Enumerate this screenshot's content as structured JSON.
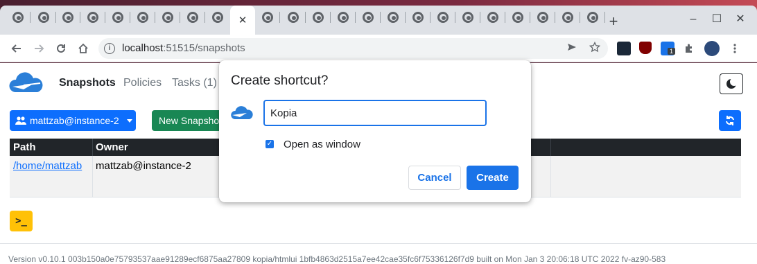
{
  "browser": {
    "active_tab_close_glyph": "✕",
    "new_tab_glyph": "+",
    "window_controls": [
      "–",
      "☐",
      "✕"
    ],
    "url_host": "localhost",
    "url_rest": ":51515/snapshots",
    "extension_badge": "1",
    "colors": {
      "tab_strip": "#dee1e6",
      "accent": "#1a73e8"
    }
  },
  "app": {
    "nav": {
      "snapshots": "Snapshots",
      "policies": "Policies",
      "tasks": "Tasks (1)"
    },
    "user_button": "mattzab@instance-2",
    "new_snapshot_button": "New Snapshot",
    "table": {
      "headers": [
        "Path",
        "Owner"
      ],
      "rows": [
        {
          "path": "/home/mattzab",
          "owner": "mattzab@instance-2"
        }
      ]
    },
    "terminal_button": ">_",
    "footer": "Version v0.10.1 003b150a0e75793537aae91289ecf6875aa27809 kopia/htmlui 1bfb4863d2515a7ee42cae35fc6f75336126f7d9 built on Mon Jan 3 20:06:18 UTC 2022 fv-az90-583",
    "colors": {
      "primary": "#0d6efd",
      "success": "#198754",
      "warning": "#ffc107",
      "dark": "#212529"
    }
  },
  "dialog": {
    "title": "Create shortcut?",
    "name_value": "Kopia",
    "open_as_window_label": "Open as window",
    "open_as_window_checked": true,
    "cancel_label": "Cancel",
    "create_label": "Create"
  }
}
